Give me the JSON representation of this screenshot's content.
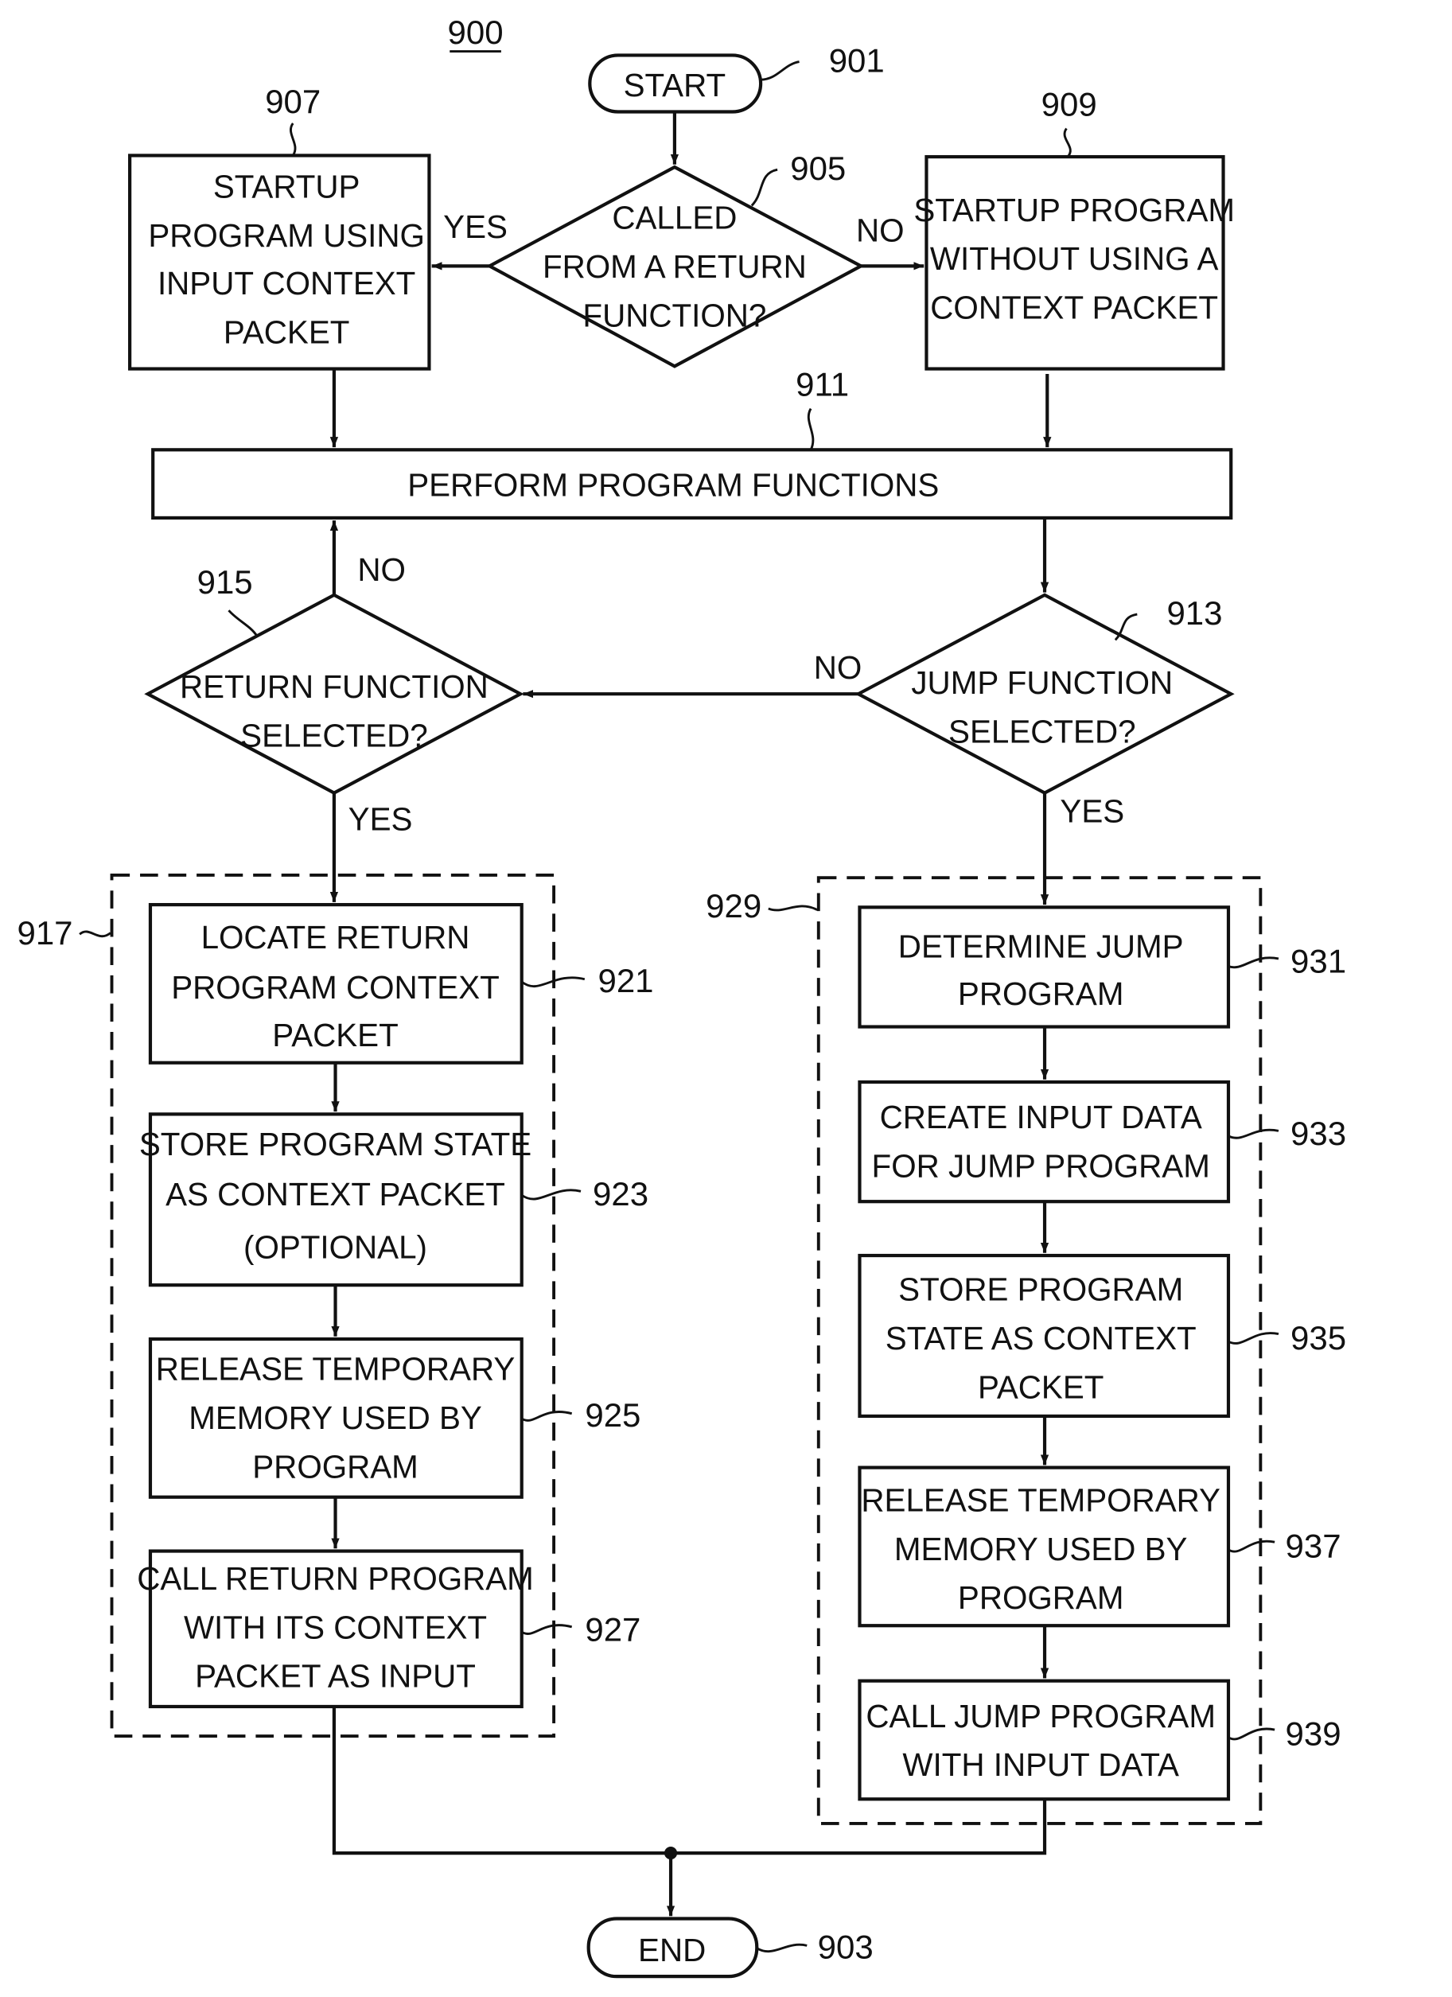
{
  "figure": {
    "number": "900",
    "nodes": {
      "start": {
        "ref": "901",
        "lines": [
          "START"
        ]
      },
      "end": {
        "ref": "903",
        "lines": [
          "END"
        ]
      },
      "called_from_return": {
        "ref": "905",
        "lines": [
          "CALLED",
          "FROM A RETURN",
          "FUNCTION?"
        ]
      },
      "startup_with_context": {
        "ref": "907",
        "lines": [
          "STARTUP",
          "PROGRAM USING",
          "INPUT CONTEXT",
          "PACKET"
        ]
      },
      "startup_without_context": {
        "ref": "909",
        "lines": [
          "STARTUP PROGRAM",
          "WITHOUT USING A",
          "CONTEXT PACKET"
        ]
      },
      "perform_functions": {
        "ref": "911",
        "lines": [
          "PERFORM PROGRAM FUNCTIONS"
        ]
      },
      "jump_selected": {
        "ref": "913",
        "lines": [
          "JUMP FUNCTION",
          "SELECTED?"
        ]
      },
      "return_selected": {
        "ref": "915",
        "lines": [
          "RETURN FUNCTION",
          "SELECTED?"
        ]
      },
      "return_group": {
        "ref": "917"
      },
      "locate_return_packet": {
        "ref": "921",
        "lines": [
          "LOCATE RETURN",
          "PROGRAM CONTEXT",
          "PACKET"
        ]
      },
      "store_state_optional": {
        "ref": "923",
        "lines": [
          "STORE PROGRAM STATE",
          "AS CONTEXT PACKET",
          "(OPTIONAL)"
        ]
      },
      "release_memory_return": {
        "ref": "925",
        "lines": [
          "RELEASE TEMPORARY",
          "MEMORY USED BY",
          "PROGRAM"
        ]
      },
      "call_return_program": {
        "ref": "927",
        "lines": [
          "CALL RETURN PROGRAM",
          "WITH ITS CONTEXT",
          "PACKET AS INPUT"
        ]
      },
      "jump_group": {
        "ref": "929"
      },
      "determine_jump": {
        "ref": "931",
        "lines": [
          "DETERMINE JUMP",
          "PROGRAM"
        ]
      },
      "create_input_data": {
        "ref": "933",
        "lines": [
          "CREATE INPUT DATA",
          "FOR JUMP PROGRAM"
        ]
      },
      "store_state_jump": {
        "ref": "935",
        "lines": [
          "STORE PROGRAM",
          "STATE AS CONTEXT",
          "PACKET"
        ]
      },
      "release_memory_jump": {
        "ref": "937",
        "lines": [
          "RELEASE TEMPORARY",
          "MEMORY USED BY",
          "PROGRAM"
        ]
      },
      "call_jump_program": {
        "ref": "939",
        "lines": [
          "CALL JUMP PROGRAM",
          "WITH INPUT DATA"
        ]
      }
    },
    "edge_labels": {
      "yes_905": "YES",
      "no_905": "NO",
      "no_915": "NO",
      "yes_915": "YES",
      "no_913": "NO",
      "yes_913": "YES"
    }
  }
}
